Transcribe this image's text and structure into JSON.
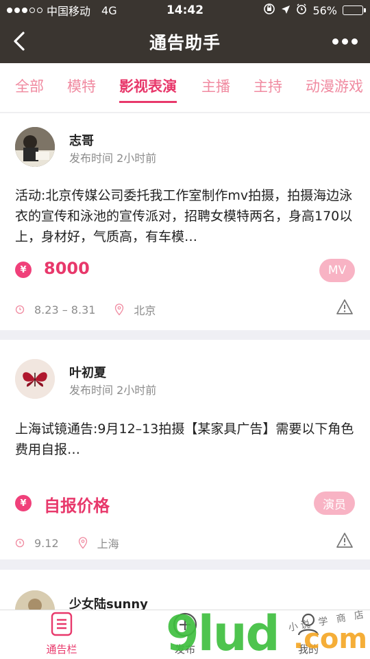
{
  "status_bar": {
    "carrier": "中国移动",
    "network": "4G",
    "time": "14:42",
    "battery": "56%",
    "battery_level": 0.56
  },
  "nav": {
    "title": "通告助手"
  },
  "tabs": [
    {
      "label": "全部",
      "active": false
    },
    {
      "label": "模特",
      "active": false
    },
    {
      "label": "影视表演",
      "active": true
    },
    {
      "label": "主播",
      "active": false
    },
    {
      "label": "主持",
      "active": false
    },
    {
      "label": "动漫游戏",
      "active": false
    }
  ],
  "posts": [
    {
      "user": "志哥",
      "time": "发布时间 2小时前",
      "content": "活动:北京传媒公司委托我工作室制作mv拍摄，拍摄海边泳衣的宣传和泳池的宣传派对，招聘女模特两名，身高170以上，身材好，气质高，有车模…",
      "price_icon": "¥",
      "price": "8000",
      "tag": "MV",
      "date": "8.23 – 8.31",
      "location": "北京"
    },
    {
      "user": "叶初夏",
      "time": "发布时间 2小时前",
      "content": "上海试镜通告:9月12–13拍摄【某家具广告】需要以下角色\n费用自报…",
      "price_icon": "¥",
      "price": "自报价格",
      "tag": "演员",
      "date": "9.12",
      "location": "上海"
    },
    {
      "user": "少女陆sunny"
    }
  ],
  "bottom_nav": [
    {
      "label": "通告栏",
      "active": true
    },
    {
      "label": "发布",
      "active": false
    },
    {
      "label": "我的",
      "active": false
    }
  ],
  "watermark": {
    "text": "9lud",
    "suffix": ".com",
    "small": "小说 学 商 店"
  },
  "colors": {
    "accent": "#e8386b",
    "tab_inactive": "#f08aa0",
    "badge": "#f8b3c4",
    "header_bg": "#3a3530"
  }
}
